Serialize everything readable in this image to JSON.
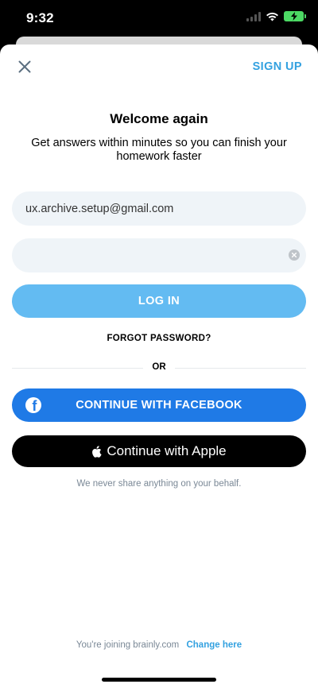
{
  "status_bar": {
    "time": "9:32"
  },
  "header": {
    "signup_label": "SIGN UP"
  },
  "main": {
    "title": "Welcome again",
    "subtitle": "Get answers within minutes so you can finish your homework faster",
    "email_value": "ux.archive.setup@gmail.com",
    "password_value": "",
    "login_label": "LOG IN",
    "forgot_label": "FORGOT PASSWORD?",
    "or_label": "OR",
    "facebook_label": "CONTINUE WITH FACEBOOK",
    "apple_label": "Continue with Apple",
    "note": "We never share anything on your behalf."
  },
  "footer": {
    "joining_text": "You're joining brainly.com",
    "change_label": "Change here"
  },
  "colors": {
    "accent": "#33a1e0",
    "login_button": "#63bbf2",
    "facebook": "#1f7ae6",
    "apple": "#000000",
    "field_bg": "#eff4f8"
  },
  "icons": [
    "close-icon",
    "clear-icon",
    "facebook-icon",
    "apple-icon",
    "wifi-icon",
    "battery-icon"
  ]
}
